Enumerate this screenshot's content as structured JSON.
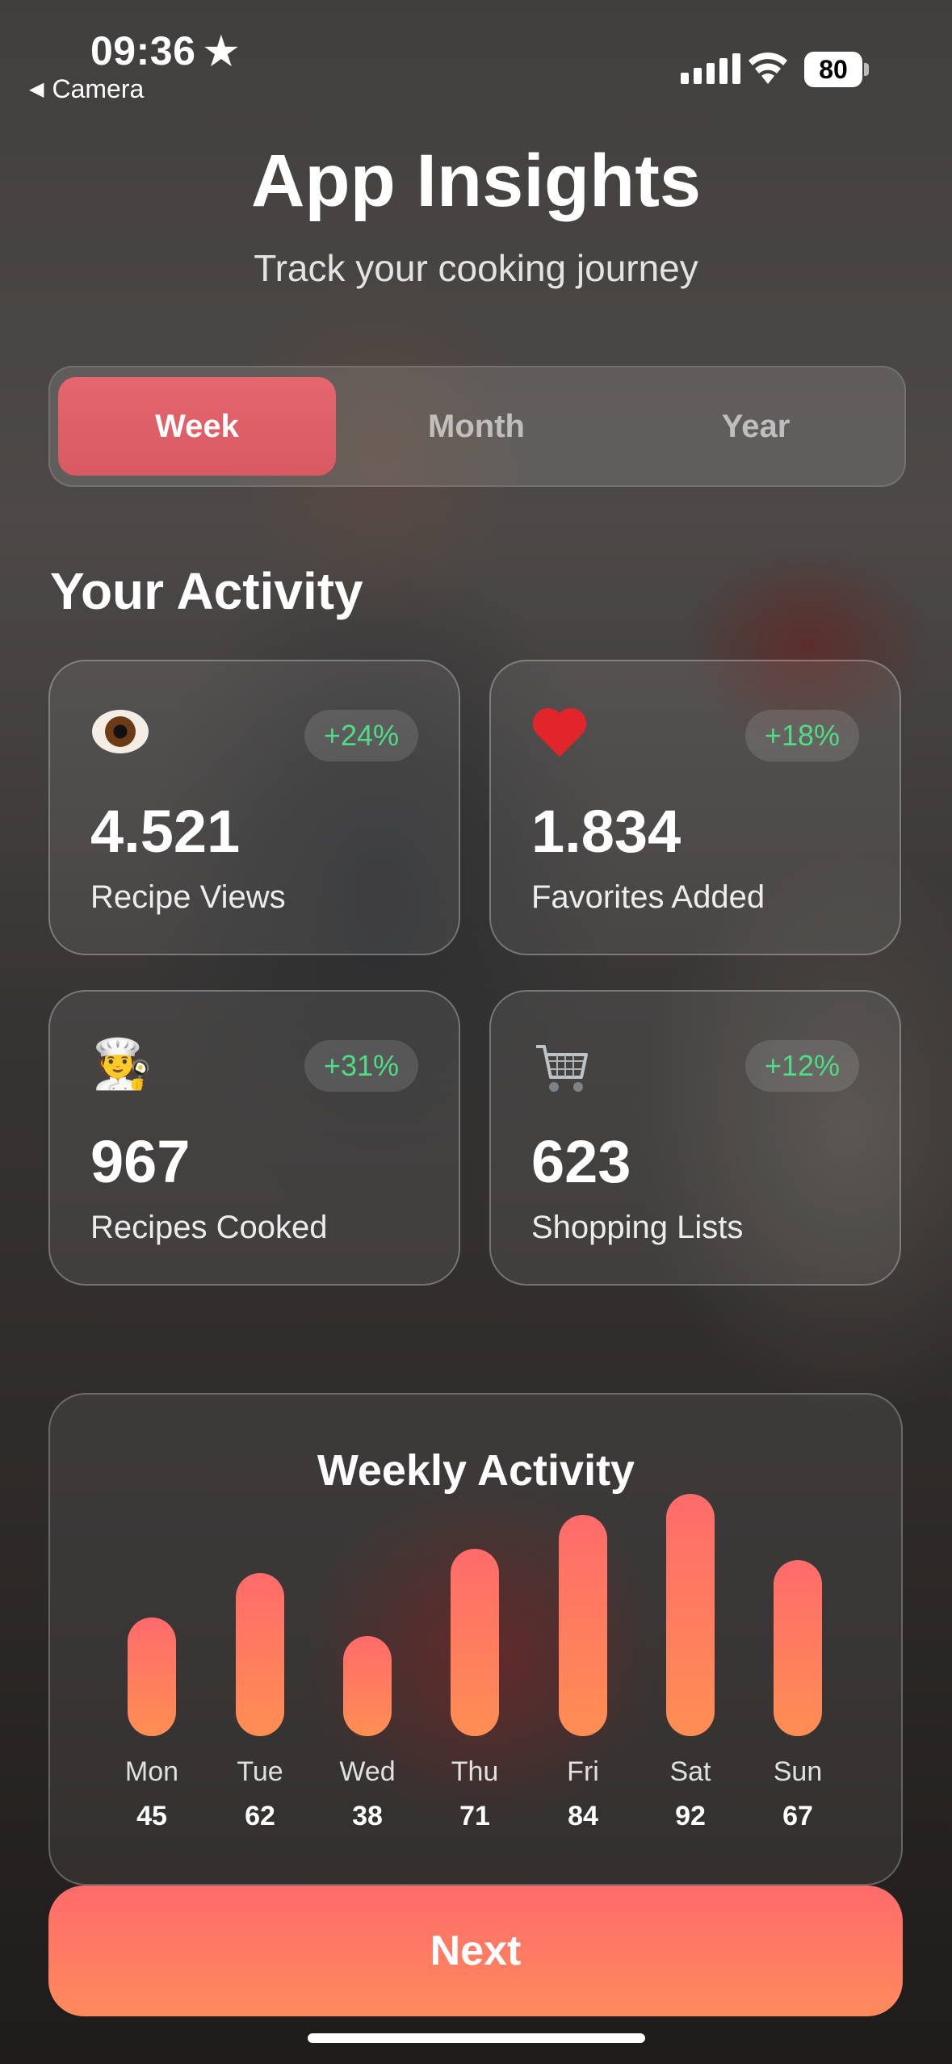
{
  "status_bar": {
    "time": "09:36",
    "back_label": "Camera",
    "battery": "80"
  },
  "header": {
    "title": "App Insights",
    "subtitle": "Track your cooking journey"
  },
  "period_tabs": [
    {
      "label": "Week",
      "active": true
    },
    {
      "label": "Month",
      "active": false
    },
    {
      "label": "Year",
      "active": false
    }
  ],
  "section_title": "Your Activity",
  "stats": [
    {
      "icon": "eye-icon",
      "change": "+24%",
      "value": "4.521",
      "label": "Recipe Views"
    },
    {
      "icon": "heart-icon",
      "change": "+18%",
      "value": "1.834",
      "label": "Favorites Added"
    },
    {
      "icon": "chef-icon",
      "change": "+31%",
      "value": "967",
      "label": "Recipes Cooked"
    },
    {
      "icon": "shopping-cart-icon",
      "change": "+12%",
      "value": "623",
      "label": "Shopping Lists"
    }
  ],
  "chart_data": {
    "type": "bar",
    "title": "Weekly Activity",
    "categories": [
      "Mon",
      "Tue",
      "Wed",
      "Thu",
      "Fri",
      "Sat",
      "Sun"
    ],
    "values": [
      45,
      62,
      38,
      71,
      84,
      92,
      67
    ],
    "value_labels": [
      "45",
      "62",
      "38",
      "71",
      "84",
      "92",
      "67"
    ],
    "colors": {
      "bar_top": "#ff6b6b",
      "bar_bottom": "#ff8e53"
    }
  },
  "next_button": "Next",
  "colors": {
    "accent": "#e5666c",
    "positive": "#4fdc84",
    "cta": "#ff7a5c"
  }
}
